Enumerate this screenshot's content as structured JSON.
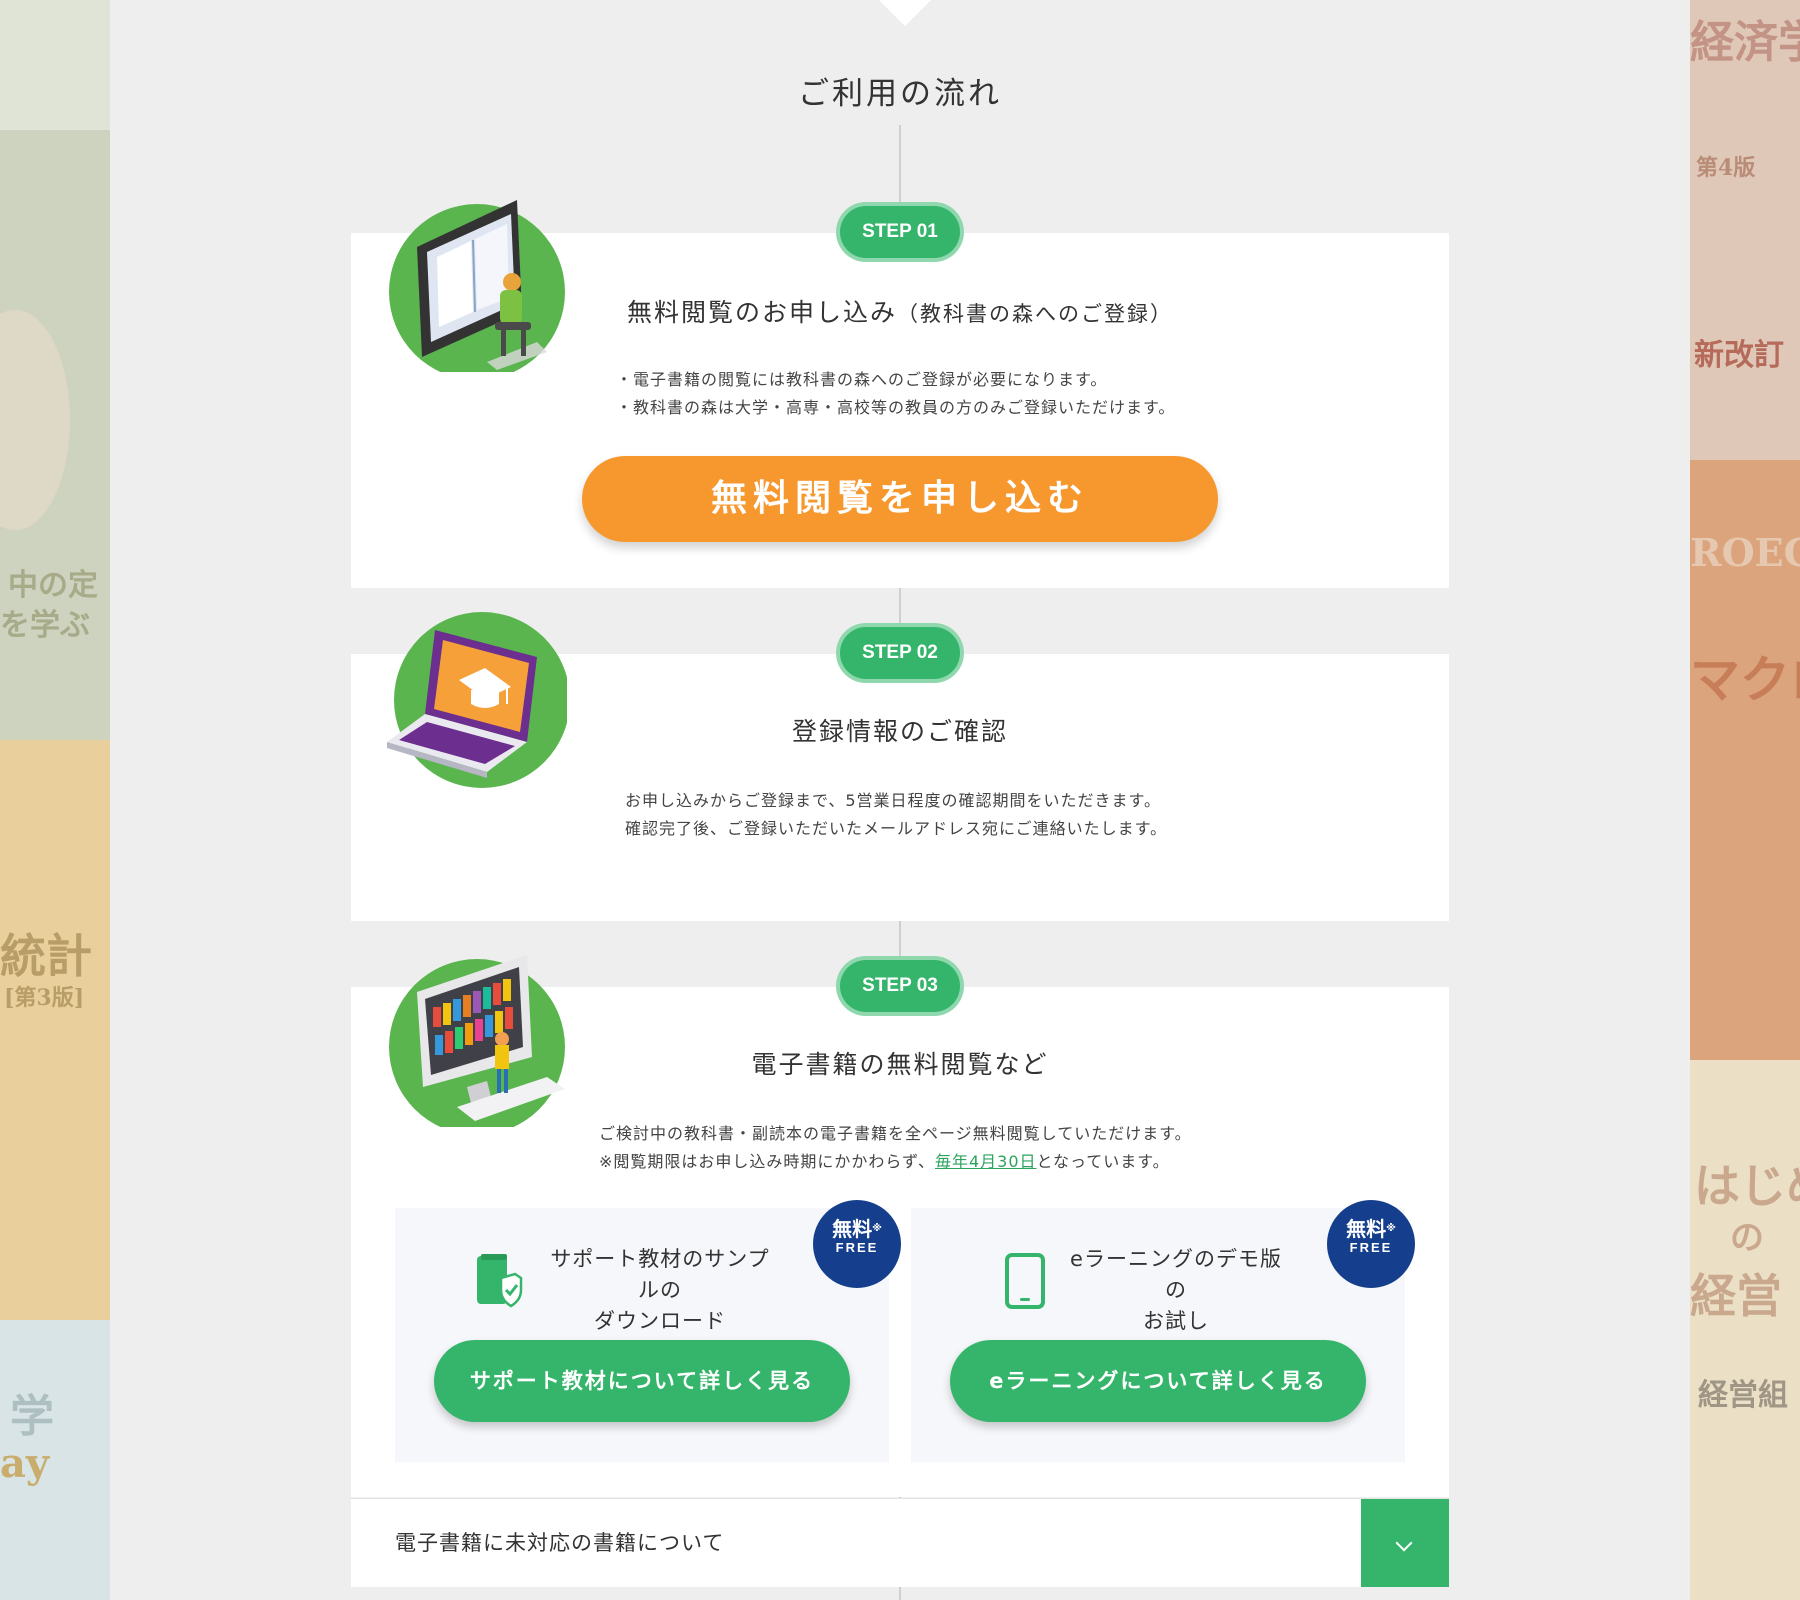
{
  "section": {
    "title": "ご利用の流れ"
  },
  "steps": [
    {
      "badge": "STEP 01",
      "title": "無料閲覧のお申し込み",
      "title_sub": "（教科書の森へのご登録）",
      "lines": [
        "・電子書籍の閲覧には教科書の森へのご登録が必要になります。",
        "・教科書の森は大学・高専・高校等の教員の方のみご登録いただけます。"
      ],
      "button": "無料閲覧を申し込む"
    },
    {
      "badge": "STEP 02",
      "title": "登録情報のご確認",
      "lines": [
        "お申し込みからご登録まで、5営業日程度の確認期間をいただきます。",
        "確認完了後、ご登録いただいたメールアドレス宛にご連絡いたします。"
      ]
    },
    {
      "badge": "STEP 03",
      "title": "電子書籍の無料閲覧など",
      "line1": "ご検討中の教科書・副読本の電子書籍を全ページ無料閲覧していただけます。",
      "line2_pre": "※閲覧期限はお申し込み時期にかかわらず、",
      "line2_link": "毎年4月30日",
      "line2_post": "となっています。",
      "cards": [
        {
          "text1": "サポート教材のサンプルの",
          "text2": "ダウンロード",
          "icon": "document-shield-icon",
          "badge_jp": "無料",
          "badge_mark": "※",
          "badge_en": "FREE",
          "button": "サポート教材について詳しく見る"
        },
        {
          "text1": "eラーニングのデモ版の",
          "text2": "お試し",
          "icon": "tablet-icon",
          "badge_jp": "無料",
          "badge_mark": "※",
          "badge_en": "FREE",
          "button": "eラーニングについて詳しく見る"
        }
      ]
    }
  ],
  "accordion": {
    "label": "電子書籍に未対応の書籍について",
    "icon": "chevron-down-icon"
  },
  "background": {
    "left_texts": [
      "統計",
      "[第3版]",
      "中の定",
      "を学ぶ",
      "学",
      "ay"
    ],
    "right_texts": [
      "経済学",
      "第4版",
      "新改訂",
      "ROECO",
      "マクロ",
      "はじめ",
      "の",
      "経営",
      "経営組"
    ]
  },
  "colors": {
    "green": "#35b56b",
    "orange": "#f7982f",
    "navy": "#153f8c",
    "link": "#2aa45c"
  }
}
